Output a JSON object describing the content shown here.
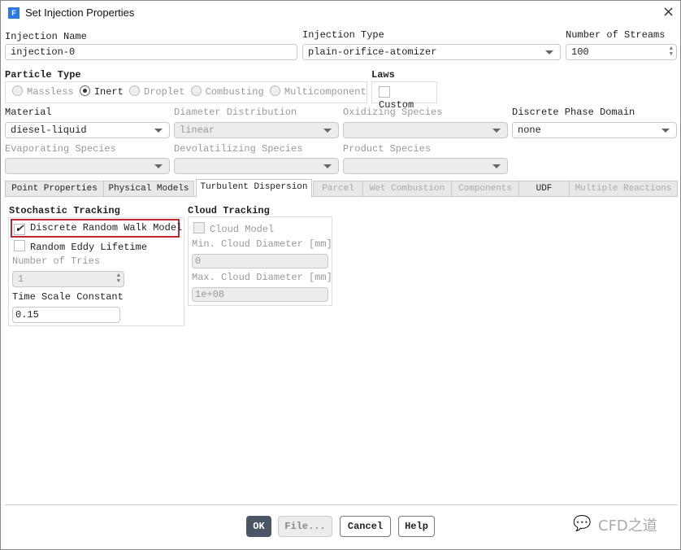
{
  "window": {
    "title": "Set Injection Properties",
    "app_icon": "F",
    "close_icon": "×"
  },
  "injection_name": {
    "label": "Injection Name",
    "value": "injection-0"
  },
  "injection_type": {
    "label": "Injection Type",
    "value": "plain-orifice-atomizer"
  },
  "number_of_streams": {
    "label": "Number of Streams",
    "value": "100"
  },
  "particle_type": {
    "label": "Particle Type",
    "options": [
      "Massless",
      "Inert",
      "Droplet",
      "Combusting",
      "Multicomponent"
    ],
    "selected": "Inert"
  },
  "laws": {
    "label": "Laws",
    "custom_label": "Custom",
    "custom_checked": false
  },
  "material": {
    "label": "Material",
    "value": "diesel-liquid"
  },
  "diameter_distribution": {
    "label": "Diameter Distribution",
    "value": "linear"
  },
  "oxidizing_species": {
    "label": "Oxidizing Species",
    "value": ""
  },
  "discrete_phase_domain": {
    "label": "Discrete Phase Domain",
    "value": "none"
  },
  "evaporating_species": {
    "label": "Evaporating Species",
    "value": ""
  },
  "devolatilizing_species": {
    "label": "Devolatilizing Species",
    "value": ""
  },
  "product_species": {
    "label": "Product Species",
    "value": ""
  },
  "tabs": [
    {
      "label": "Point Properties"
    },
    {
      "label": "Physical Models"
    },
    {
      "label": "Turbulent Dispersion",
      "active": true
    },
    {
      "label": "Parcel"
    },
    {
      "label": "Wet Combustion"
    },
    {
      "label": "Components"
    },
    {
      "label": "UDF"
    },
    {
      "label": "Multiple Reactions"
    }
  ],
  "stochastic": {
    "title": "Stochastic Tracking",
    "drw_label": "Discrete Random Walk Model",
    "drw_checked": true,
    "rel_label": "Random Eddy Lifetime",
    "rel_checked": false,
    "tries_label": "Number of Tries",
    "tries_value": "1",
    "tsc_label": "Time Scale Constant",
    "tsc_value": "0.15",
    "highlight_color": "#c0282d"
  },
  "cloud": {
    "title": "Cloud Tracking",
    "model_label": "Cloud Model",
    "model_checked": false,
    "min_label": "Min. Cloud Diameter [mm]",
    "min_value": "0",
    "max_label": "Max. Cloud Diameter [mm]",
    "max_value": "1e+08"
  },
  "buttons": {
    "ok": "OK",
    "file": "File...",
    "cancel": "Cancel",
    "help": "Help",
    "ok_color": "#4a5566"
  },
  "watermark": "CFD之道"
}
